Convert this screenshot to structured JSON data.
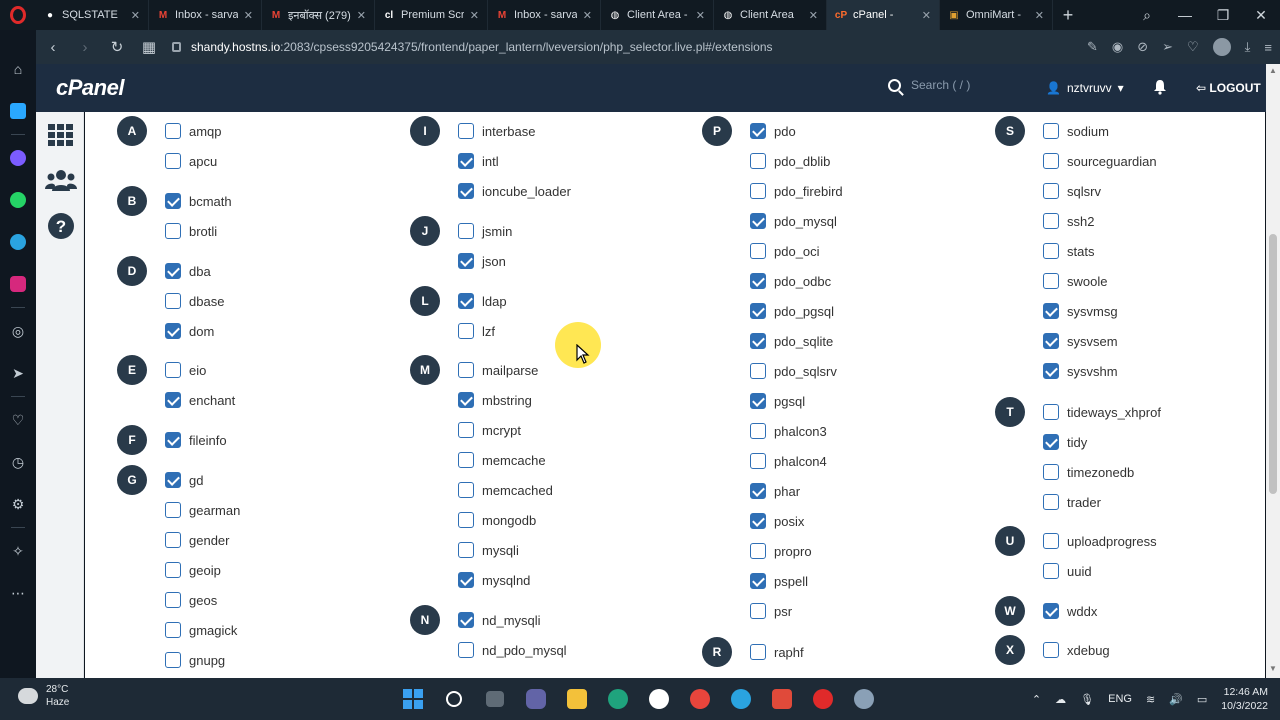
{
  "browser": {
    "tabs": [
      {
        "label": "SQLSTATE",
        "icon": "github-icon",
        "color": "#ffffff",
        "glyph": "●"
      },
      {
        "label": "Inbox - sarva",
        "icon": "gmail-icon",
        "color": "#ea4335",
        "glyph": "M"
      },
      {
        "label": "इनबॉक्स (279)",
        "icon": "gmail-icon",
        "color": "#ea4335",
        "glyph": "M"
      },
      {
        "label": "Premium Scr",
        "icon": "codecanyon-icon",
        "color": "#ffffff",
        "glyph": "cl"
      },
      {
        "label": "Inbox - sarva",
        "icon": "gmail-icon",
        "color": "#ea4335",
        "glyph": "M"
      },
      {
        "label": "Client Area -",
        "icon": "globe-icon",
        "color": "#ffffff",
        "glyph": "◍"
      },
      {
        "label": "Client Area",
        "icon": "globe-icon",
        "color": "#ffffff",
        "glyph": "◍"
      },
      {
        "label": "cPanel -",
        "icon": "cpanel-icon",
        "color": "#ff6c2c",
        "glyph": "cP",
        "active": true
      },
      {
        "label": "OmniMart -",
        "icon": "omnimart-icon",
        "color": "#e0a030",
        "glyph": "▣"
      }
    ],
    "url_host": "shandy.hostns.io",
    "url_rest": ":2083/cpsess9205424375/frontend/paper_lantern/lveversion/php_selector.live.pl#/extensions"
  },
  "cpanel": {
    "logo": "cPanel",
    "search_placeholder": "Search ( / )",
    "username": "nztvruvv",
    "logout": "LOGOUT"
  },
  "groups": [
    {
      "letter": "A",
      "items": [
        {
          "name": "amqp",
          "checked": false
        },
        {
          "name": "apcu",
          "checked": false
        }
      ]
    },
    {
      "letter": "B",
      "items": [
        {
          "name": "bcmath",
          "checked": true
        },
        {
          "name": "brotli",
          "checked": false
        }
      ]
    },
    {
      "letter": "D",
      "items": [
        {
          "name": "dba",
          "checked": true
        },
        {
          "name": "dbase",
          "checked": false
        },
        {
          "name": "dom",
          "checked": true
        }
      ]
    },
    {
      "letter": "E",
      "items": [
        {
          "name": "eio",
          "checked": false
        },
        {
          "name": "enchant",
          "checked": true
        }
      ]
    },
    {
      "letter": "F",
      "items": [
        {
          "name": "fileinfo",
          "checked": true
        }
      ]
    },
    {
      "letter": "G",
      "items": [
        {
          "name": "gd",
          "checked": true
        },
        {
          "name": "gearman",
          "checked": false
        },
        {
          "name": "gender",
          "checked": false
        },
        {
          "name": "geoip",
          "checked": false
        },
        {
          "name": "geos",
          "checked": false
        },
        {
          "name": "gmagick",
          "checked": false
        },
        {
          "name": "gnupg",
          "checked": false
        }
      ]
    },
    {
      "letter": "I",
      "items": [
        {
          "name": "interbase",
          "checked": false
        },
        {
          "name": "intl",
          "checked": true
        },
        {
          "name": "ioncube_loader",
          "checked": true
        }
      ]
    },
    {
      "letter": "J",
      "items": [
        {
          "name": "jsmin",
          "checked": false
        },
        {
          "name": "json",
          "checked": true
        }
      ]
    },
    {
      "letter": "L",
      "items": [
        {
          "name": "ldap",
          "checked": true
        },
        {
          "name": "lzf",
          "checked": false
        }
      ]
    },
    {
      "letter": "M",
      "items": [
        {
          "name": "mailparse",
          "checked": false
        },
        {
          "name": "mbstring",
          "checked": true
        },
        {
          "name": "mcrypt",
          "checked": false
        },
        {
          "name": "memcache",
          "checked": false
        },
        {
          "name": "memcached",
          "checked": false
        },
        {
          "name": "mongodb",
          "checked": false
        },
        {
          "name": "mysqli",
          "checked": false
        },
        {
          "name": "mysqlnd",
          "checked": true
        }
      ]
    },
    {
      "letter": "N",
      "items": [
        {
          "name": "nd_mysqli",
          "checked": true
        },
        {
          "name": "nd_pdo_mysql",
          "checked": false
        }
      ]
    },
    {
      "letter": "P",
      "items": [
        {
          "name": "pdo",
          "checked": true
        },
        {
          "name": "pdo_dblib",
          "checked": false
        },
        {
          "name": "pdo_firebird",
          "checked": false
        },
        {
          "name": "pdo_mysql",
          "checked": true
        },
        {
          "name": "pdo_oci",
          "checked": false
        },
        {
          "name": "pdo_odbc",
          "checked": true
        },
        {
          "name": "pdo_pgsql",
          "checked": true
        },
        {
          "name": "pdo_sqlite",
          "checked": true
        },
        {
          "name": "pdo_sqlsrv",
          "checked": false
        },
        {
          "name": "pgsql",
          "checked": true
        },
        {
          "name": "phalcon3",
          "checked": false
        },
        {
          "name": "phalcon4",
          "checked": false
        },
        {
          "name": "phar",
          "checked": true
        },
        {
          "name": "posix",
          "checked": true
        },
        {
          "name": "propro",
          "checked": false
        },
        {
          "name": "pspell",
          "checked": true
        },
        {
          "name": "psr",
          "checked": false
        }
      ]
    },
    {
      "letter": "R",
      "items": [
        {
          "name": "raphf",
          "checked": false
        }
      ]
    },
    {
      "letter": "S",
      "items": [
        {
          "name": "sodium",
          "checked": false
        },
        {
          "name": "sourceguardian",
          "checked": false
        },
        {
          "name": "sqlsrv",
          "checked": false
        },
        {
          "name": "ssh2",
          "checked": false
        },
        {
          "name": "stats",
          "checked": false
        },
        {
          "name": "swoole",
          "checked": false
        },
        {
          "name": "sysvmsg",
          "checked": true
        },
        {
          "name": "sysvsem",
          "checked": true
        },
        {
          "name": "sysvshm",
          "checked": true
        }
      ]
    },
    {
      "letter": "T",
      "items": [
        {
          "name": "tideways_xhprof",
          "checked": false
        },
        {
          "name": "tidy",
          "checked": true
        },
        {
          "name": "timezonedb",
          "checked": false
        },
        {
          "name": "trader",
          "checked": false
        }
      ]
    },
    {
      "letter": "U",
      "items": [
        {
          "name": "uploadprogress",
          "checked": false
        },
        {
          "name": "uuid",
          "checked": false
        }
      ]
    },
    {
      "letter": "W",
      "items": [
        {
          "name": "wddx",
          "checked": true
        }
      ]
    },
    {
      "letter": "X",
      "items": [
        {
          "name": "xdebug",
          "checked": false
        }
      ]
    }
  ],
  "taskbar": {
    "weather_temp": "28°C",
    "weather_desc": "Haze",
    "lang": "ENG",
    "time": "12:46 AM",
    "date": "10/3/2022"
  },
  "colors": {
    "accent": "#2f6fb5",
    "header": "#1d2d41",
    "letter_badge": "#293a4a"
  }
}
